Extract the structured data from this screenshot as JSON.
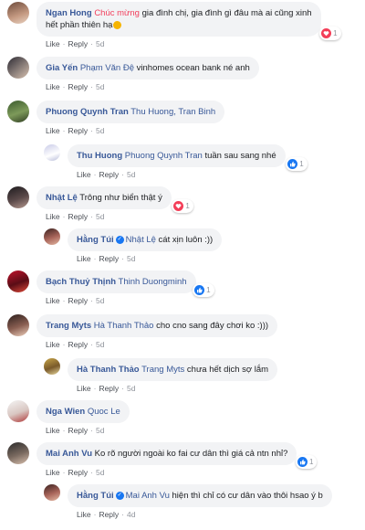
{
  "labels": {
    "like": "Like",
    "reply": "Reply",
    "dot": "·"
  },
  "comments": [
    {
      "author": "Ngan Hong",
      "highlight": "Chúc mừng",
      "text_a": " gia đình chị, gia đình gì đâu mà ai cũng xinh",
      "text_b": "hết phần thiên hạ",
      "time": "5d",
      "reaction": "heart",
      "reaction_count": "1",
      "has_emoji": true
    },
    {
      "author": "Gia Yến",
      "tag": "Phạm Văn Đệ",
      "text": " vinhomes ocean bank né anh",
      "time": "5d"
    },
    {
      "author": "Phuong Quynh Tran",
      "tag": "Thu Huong, Tran Binh",
      "text": "",
      "time": "5d"
    },
    {
      "author": "Thu Huong",
      "tag": "Phuong Quynh Tran",
      "text": " tuần sau sang nhé",
      "time": "5d",
      "reaction": "like",
      "reaction_count": "1"
    },
    {
      "author": "Nhật Lệ",
      "text": " Trông như biển thật ý",
      "time": "5d",
      "reaction": "heart",
      "reaction_count": "1"
    },
    {
      "author": "Hằng Túi",
      "tag": "Nhật Lệ",
      "text": " cát xịn luôn :))",
      "time": "5d",
      "verified": true
    },
    {
      "author": "Bạch Thuỷ Thịnh",
      "tag": "Thinh Duongminh",
      "text": "",
      "time": "5d",
      "reaction": "like",
      "reaction_count": "1"
    },
    {
      "author": "Trang Myts",
      "tag": "Hà Thanh Thảo",
      "text": " cho cno sang đây chơi ko :)))",
      "time": "5d"
    },
    {
      "author": "Hà Thanh Thảo",
      "tag": "Trang Myts",
      "text": " chưa hết dịch sợ lắm",
      "time": "5d"
    },
    {
      "author": "Nga Wien",
      "tag": "Quoc Le",
      "text": "",
      "time": "5d"
    },
    {
      "author": "Mai Anh Vu",
      "text": " Ko rõ người ngoài ko fai cư dân thì giá cả ntn nhỉ?",
      "time": "5d",
      "reaction": "like",
      "reaction_count": "1"
    },
    {
      "author": "Hằng Túi",
      "tag": "Mai Anh Vu",
      "text": " hiện thì chỉ có cư dân vào thôi hsao ý b",
      "time": "4d",
      "verified": true
    }
  ],
  "colors": {
    "name": "#385898",
    "highlight": "#f23f5c",
    "bubble": "#f2f3f5",
    "meta": "#90949c",
    "heart": "#f33e58",
    "like": "#1877f2"
  }
}
